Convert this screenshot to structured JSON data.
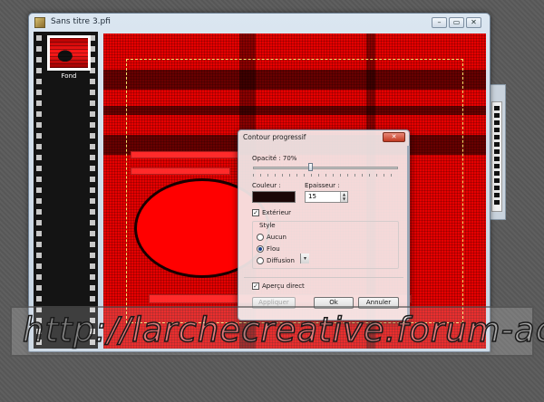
{
  "window": {
    "title": "Sans titre 3.pfi",
    "minimize": "–",
    "maximize": "▭",
    "close": "✕"
  },
  "layers": [
    {
      "name": "Fond"
    }
  ],
  "dialog": {
    "title": "Contour progressif",
    "close": "✕",
    "opacity_label": "Opacité : 70%",
    "opacity_value": 0.7,
    "color_label": "Couleur :",
    "color_value": "#1a0707",
    "thickness_label": "Epaisseur :",
    "thickness_value": "15",
    "exterior_label": "Extérieur",
    "exterior_checked": true,
    "style_label": "Style",
    "styles": [
      {
        "label": "Aucun",
        "selected": false
      },
      {
        "label": "Flou",
        "selected": true
      },
      {
        "label": "Diffusion",
        "selected": false
      }
    ],
    "preview_label": "Aperçu direct",
    "preview_checked": true,
    "apply_button": "Appliquer",
    "ok_button": "Ok",
    "cancel_button": "Annuler"
  },
  "watermark": "http://larchecreative.forum-actif.net/"
}
